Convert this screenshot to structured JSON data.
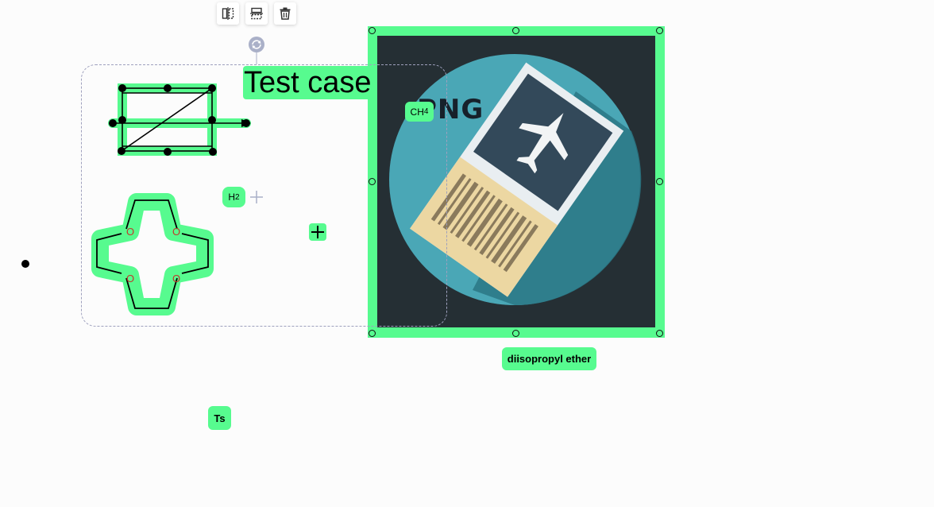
{
  "toolbar": {
    "buttons": [
      {
        "name": "flip-horizontal-button",
        "icon": "flip-horizontal-icon"
      },
      {
        "name": "flip-vertical-button",
        "icon": "flip-vertical-icon"
      },
      {
        "name": "delete-button",
        "icon": "trash-icon"
      }
    ]
  },
  "rotate_handle": {
    "icon": "rotate-icon"
  },
  "canvas": {
    "text_label": "Test case",
    "chips": {
      "h2": {
        "base": "H",
        "sub": "2"
      },
      "ch4": {
        "base": "CH",
        "sub": "4"
      },
      "diisopropyl": "diisopropyl ether",
      "ts": "Ts"
    },
    "image": {
      "watermark_text": "PNG",
      "icon": "airplane-ticket-icon"
    },
    "crown_ether_atoms": [
      "O",
      "O",
      "O",
      "O"
    ]
  },
  "colors": {
    "highlight": "#57fb8f",
    "image_bg": "#252f34",
    "circle": "#4aa7b6",
    "oxygen": "#c0392b"
  }
}
